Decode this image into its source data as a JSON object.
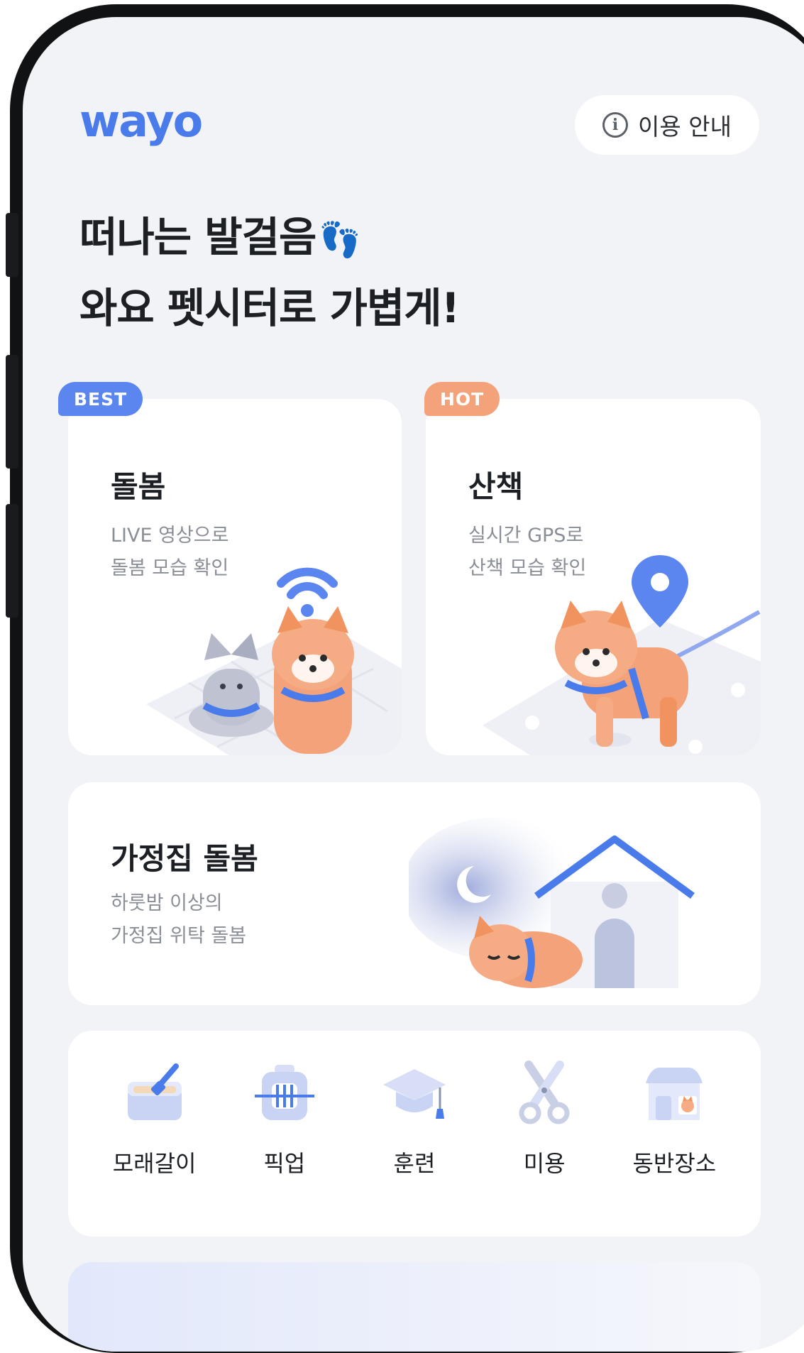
{
  "header": {
    "logo": "wayo",
    "guide_label": "이용 안내"
  },
  "headline": {
    "line1": "떠나는 발걸음",
    "line2": "와요 펫시터로 가볍게!"
  },
  "cards": {
    "care": {
      "badge": "BEST",
      "title": "돌봄",
      "desc_line1": "LIVE 영상으로",
      "desc_line2": "돌봄 모습 확인"
    },
    "walk": {
      "badge": "HOT",
      "title": "산책",
      "desc_line1": "실시간 GPS로",
      "desc_line2": "산책 모습 확인"
    },
    "home": {
      "title": "가정집 돌봄",
      "desc_line1": "하룻밤 이상의",
      "desc_line2": "가정집 위탁 돌봄"
    }
  },
  "services": [
    {
      "label": "모래갈이",
      "icon": "litter-box-icon"
    },
    {
      "label": "픽업",
      "icon": "pet-carrier-icon"
    },
    {
      "label": "훈련",
      "icon": "graduation-cap-icon"
    },
    {
      "label": "미용",
      "icon": "scissors-icon"
    },
    {
      "label": "동반장소",
      "icon": "pet-friendly-store-icon"
    }
  ],
  "colors": {
    "brand": "#4a7bea",
    "best_badge": "#5b86f0",
    "hot_badge": "#f4a27a",
    "background": "#f2f3f6"
  }
}
